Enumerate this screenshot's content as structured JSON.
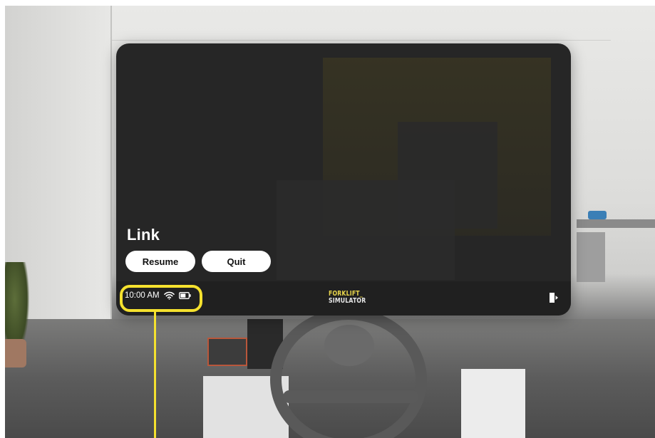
{
  "menu": {
    "title": "Link",
    "resume_label": "Resume",
    "quit_label": "Quit"
  },
  "status_bar": {
    "time": "10:00 AM",
    "wifi_icon": "wifi-icon",
    "battery_icon": "battery-icon",
    "exit_icon": "exit-icon"
  },
  "logo": {
    "line1": "FORKLIFT_",
    "line2": "SIMULATOR"
  },
  "colors": {
    "highlight": "#f5e12e",
    "panel": "#262626",
    "logo_accent": "#e7d44b"
  }
}
